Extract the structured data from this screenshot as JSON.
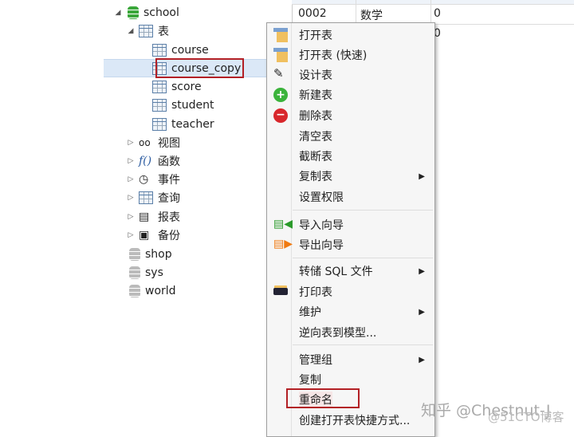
{
  "tree": {
    "school": "school",
    "tables_folder": "表",
    "tables": [
      "course",
      "course_copy",
      "score",
      "student",
      "teacher"
    ],
    "folders": [
      "视图",
      "函数",
      "事件",
      "查询",
      "报表",
      "备份"
    ],
    "databases": [
      "shop",
      "sys",
      "world"
    ]
  },
  "grid": {
    "row1": [
      "0002",
      "数学",
      "0"
    ],
    "row2_col3": "0"
  },
  "menu": {
    "items": [
      "打开表",
      "打开表 (快速)",
      "设计表",
      "新建表",
      "删除表",
      "清空表",
      "截断表",
      "复制表",
      "设置权限",
      "导入向导",
      "导出向导",
      "转储 SQL 文件",
      "打印表",
      "维护",
      "逆向表到模型...",
      "管理组",
      "复制",
      "重命名",
      "创建打开表快捷方式..."
    ]
  },
  "highlight_color": "#b32025",
  "watermark": {
    "zhihu": "知乎 @Chestnut-J",
    "cto": "@51CTO博客"
  }
}
